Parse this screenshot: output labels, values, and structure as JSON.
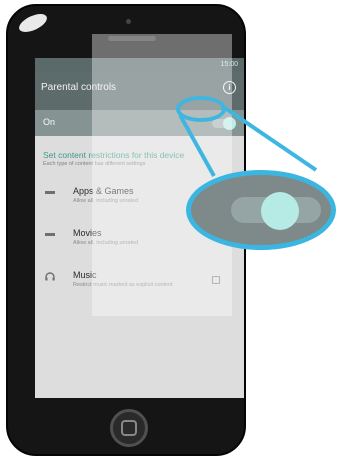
{
  "status": {
    "time": "15:00"
  },
  "appbar": {
    "title": "Parental controls"
  },
  "master": {
    "label": "On"
  },
  "section": {
    "heading": "Set content restrictions for this device",
    "description": "Each type of content has different settings"
  },
  "items": [
    {
      "name": "Apps & Games",
      "sub": "Allow all, including unrated"
    },
    {
      "name": "Movies",
      "sub": "Allow all, including unrated"
    },
    {
      "name": "Music",
      "sub": "Restrict music marked as explicit content"
    }
  ],
  "colors": {
    "accent": "#3fb6e0",
    "teal": "#3f9a88"
  }
}
